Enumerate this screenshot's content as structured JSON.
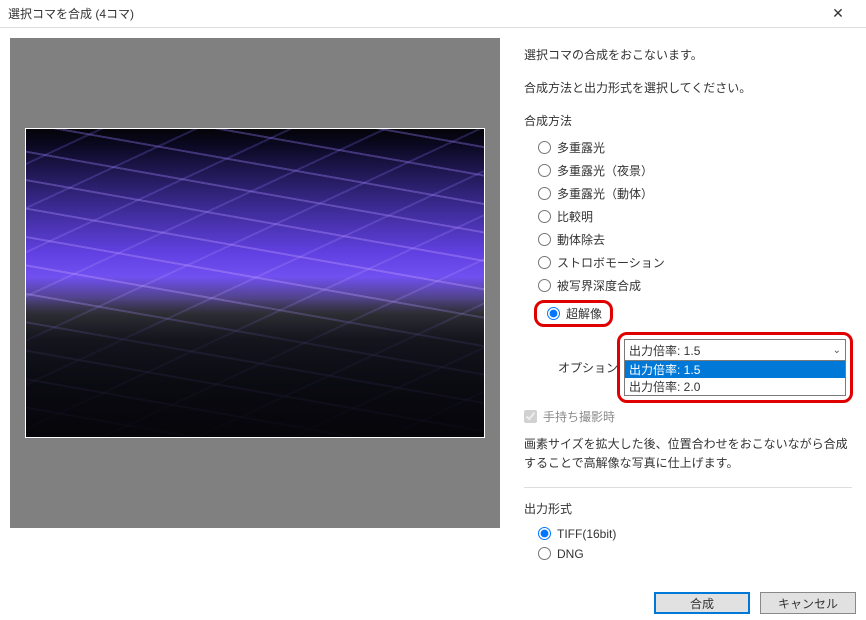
{
  "window": {
    "title": "選択コマを合成 (4コマ)"
  },
  "desc": {
    "line1": "選択コマの合成をおこないます。",
    "line2": "合成方法と出力形式を選択してください。"
  },
  "method": {
    "heading": "合成方法",
    "options": {
      "multi_exposure": "多重露光",
      "multi_exposure_night": "多重露光（夜景）",
      "multi_exposure_moving": "多重露光（動体）",
      "lighten": "比較明",
      "moving_removal": "動体除去",
      "strobe_motion": "ストロボモーション",
      "focus_stack": "被写界深度合成",
      "super_res": "超解像"
    },
    "selected": "super_res",
    "option_label": "オプション",
    "scale_select": {
      "current": "出力倍率: 1.5",
      "items": [
        "出力倍率: 1.5",
        "出力倍率: 2.0"
      ],
      "highlighted_index": 0
    },
    "handheld": {
      "label": "手持ち撮影時",
      "checked": true,
      "disabled": true
    },
    "note": "画素サイズを拡大した後、位置合わせをおこないながら合成することで高解像な写真に仕上げます。"
  },
  "output": {
    "heading": "出力形式",
    "options": {
      "tiff16": "TIFF(16bit)",
      "dng": "DNG"
    },
    "selected": "tiff16"
  },
  "buttons": {
    "ok": "合成",
    "cancel": "キャンセル"
  }
}
